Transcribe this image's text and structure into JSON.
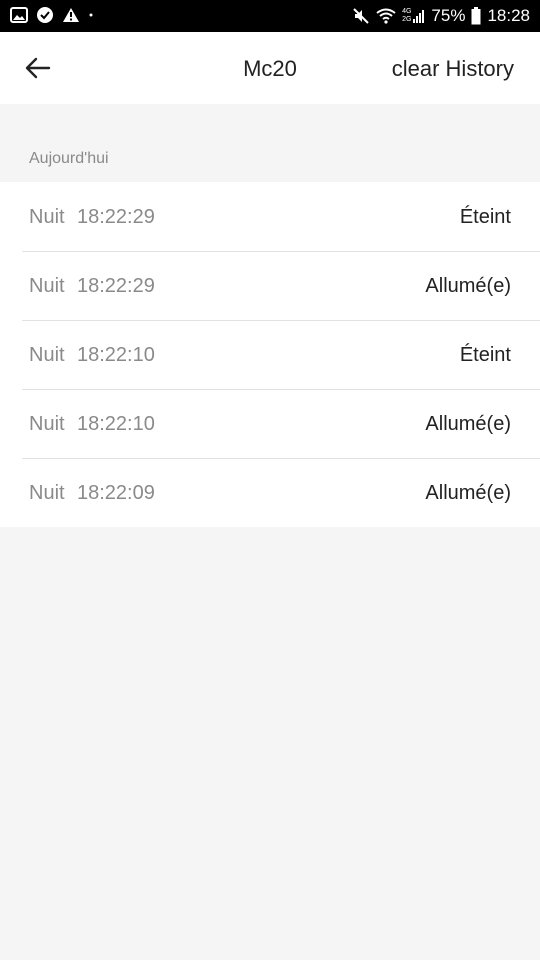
{
  "status_bar": {
    "battery": "75%",
    "time": "18:28",
    "network_top": "4G",
    "network_bottom": "2G"
  },
  "header": {
    "title": "Mc20",
    "clear_label": "clear History"
  },
  "section": {
    "label": "Aujourd'hui"
  },
  "history": [
    {
      "period": "Nuit",
      "time": "18:22:29",
      "state": "Éteint"
    },
    {
      "period": "Nuit",
      "time": "18:22:29",
      "state": "Allumé(e)"
    },
    {
      "period": "Nuit",
      "time": "18:22:10",
      "state": "Éteint"
    },
    {
      "period": "Nuit",
      "time": "18:22:10",
      "state": "Allumé(e)"
    },
    {
      "period": "Nuit",
      "time": "18:22:09",
      "state": "Allumé(e)"
    }
  ]
}
